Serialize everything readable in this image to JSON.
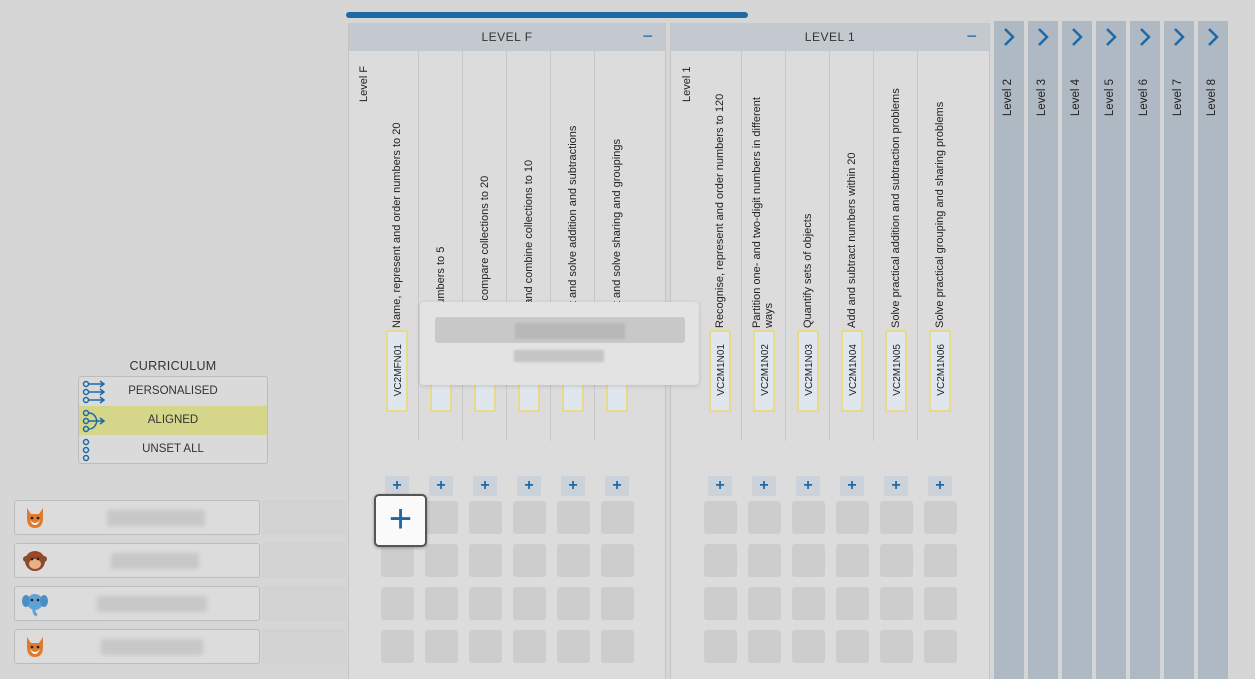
{
  "levels_expanded": [
    {
      "title": "LEVEL F",
      "side_label": "Level F",
      "collapse_glyph": "−",
      "outcomes": [
        {
          "text": "Name, represent and order numbers to 20",
          "code": "VC2MFN01"
        },
        {
          "text": "ise numbers to 5",
          "code": "VC"
        },
        {
          "text": "t and compare collections to 20",
          "code": "VC"
        },
        {
          "text": "sion and combine collections to 10",
          "code": "VC"
        },
        {
          "text": "esent and solve addition and subtractions",
          "code": "VC"
        },
        {
          "text": "esent and solve sharing and groupings",
          "code": "VC"
        }
      ]
    },
    {
      "title": "LEVEL 1",
      "side_label": "Level 1",
      "collapse_glyph": "−",
      "outcomes": [
        {
          "text": "Recognise, represent and order numbers to 120",
          "code": "VC2M1N01"
        },
        {
          "text": "Partition one- and two-digit numbers in different ways",
          "code": "VC2M1N02"
        },
        {
          "text": "Quantify sets of objects",
          "code": "VC2M1N03"
        },
        {
          "text": "Add and subtract numbers within 20",
          "code": "VC2M1N04"
        },
        {
          "text": "Solve practical addition and subtraction problems",
          "code": "VC2M1N05"
        },
        {
          "text": "Solve practical grouping and sharing problems",
          "code": "VC2M1N06"
        }
      ]
    }
  ],
  "levels_collapsed": [
    "Level 2",
    "Level 3",
    "Level 4",
    "Level 5",
    "Level 6",
    "Level 7",
    "Level 8"
  ],
  "add_glyph": "+",
  "curriculum": {
    "title": "CURRICULUM",
    "options": [
      {
        "label": "PERSONALISED",
        "icon": "personalised-icon",
        "active": false
      },
      {
        "label": "ALIGNED",
        "icon": "aligned-icon",
        "active": true
      },
      {
        "label": "UNSET ALL",
        "icon": "unset-icon",
        "active": false
      }
    ]
  },
  "students": [
    {
      "avatar": "fox-avatar"
    },
    {
      "avatar": "monkey-avatar"
    },
    {
      "avatar": "elephant-avatar"
    },
    {
      "avatar": "fox-avatar"
    }
  ],
  "colors": {
    "accent": "#1f69a7",
    "active_row": "#d5d68a",
    "code_border": "#e8d98b",
    "collapsed_column": "#aeb9c3"
  }
}
